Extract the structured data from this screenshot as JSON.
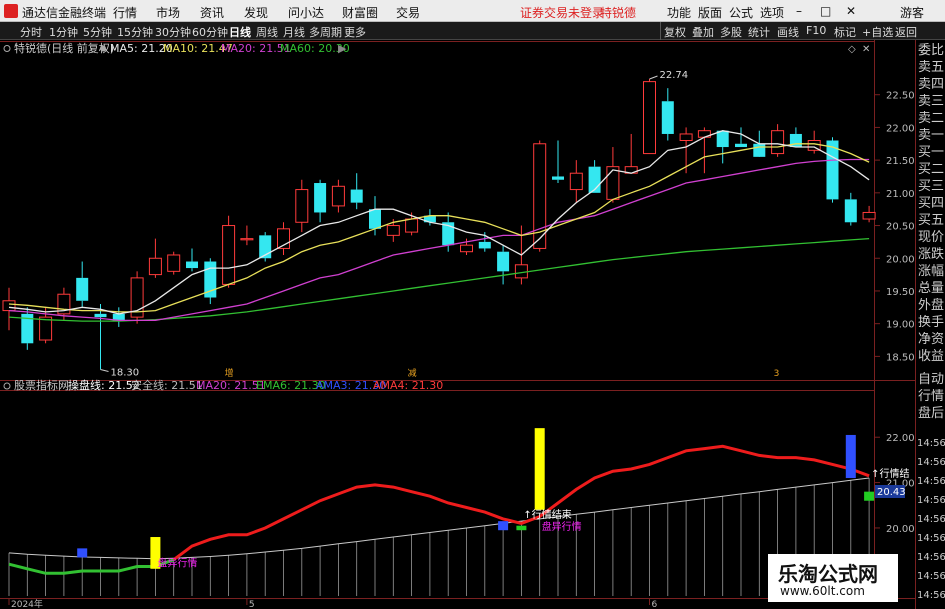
{
  "window": {
    "app_title": "通达信金融终端",
    "notice": "证券交易未登录",
    "stock": "特锐德",
    "min_btn": "–",
    "max_btn": "□",
    "close_btn": "✕"
  },
  "menu": {
    "left": [
      "行情",
      "市场",
      "资讯",
      "发现",
      "问小达",
      "财富圈",
      "交易"
    ],
    "right": [
      "功能",
      "版面",
      "公式",
      "选项"
    ],
    "guest": "游客"
  },
  "toolbar": {
    "periods": [
      "分时",
      "1分钟",
      "5分钟",
      "15分钟",
      "30分钟",
      "60分钟",
      "日线",
      "周线",
      "月线",
      "多周期",
      "更多"
    ],
    "active": "日线",
    "funcs": [
      "复权",
      "叠加",
      "多股",
      "统计",
      "画线",
      "F10",
      "标记",
      "+自选",
      "返回"
    ]
  },
  "colors": {
    "up": "#ff3b3b",
    "down": "#34e7f0",
    "ma5": "#e8e8e8",
    "ma10": "#e8e05a",
    "ma20": "#d040d0",
    "ma60": "#32c032",
    "buy": "#ee22ee"
  },
  "main_panel": {
    "title": "特锐德(日线 前复权)",
    "legend": [
      {
        "text": "MA5: 21.20",
        "color": "#e8e8e8"
      },
      {
        "text": "MA10: 21.47",
        "color": "#e8e05a"
      },
      {
        "text": "MA20: 21.51",
        "color": "#d040d0"
      },
      {
        "text": "MA60: 20.30",
        "color": "#32c032"
      }
    ],
    "high_label": "22.74",
    "low_label": "18.30",
    "events": [
      {
        "i": 12,
        "text": "增"
      },
      {
        "i": 22,
        "text": "减"
      },
      {
        "i": 42,
        "text": "3"
      }
    ]
  },
  "sub_panel": {
    "title": "股票指标网",
    "legend": [
      {
        "text": "操盘线: 21.52",
        "color": "#ffffff"
      },
      {
        "text": "安全线: 21.51",
        "color": "#bbbbbb"
      },
      {
        "text": "MA20: 21.51",
        "color": "#d040d0"
      },
      {
        "text": "EMA6: 21.30",
        "color": "#32c032"
      },
      {
        "text": "AMA3: 21.30",
        "color": "#3050ff"
      },
      {
        "text": "AMA4: 21.30",
        "color": "#ff3b3b"
      }
    ],
    "current_value": "20.43",
    "texts": [
      {
        "i": 8,
        "v": 19.15,
        "text": "盘异行情",
        "color": "#ee22ee"
      },
      {
        "i": 29,
        "v": 19.95,
        "text": "盘异行情",
        "color": "#ee22ee"
      },
      {
        "i": 28,
        "v": 20.22,
        "text": "↑行情结束",
        "color": "#ffffff"
      },
      {
        "i": 47,
        "v": 21.12,
        "text": "↑行情结",
        "color": "#ffffff"
      }
    ]
  },
  "x_labels": [
    {
      "i": 0,
      "text": "2024年"
    },
    {
      "i": 13,
      "text": "5"
    },
    {
      "i": 35,
      "text": "6"
    }
  ],
  "right_sidebar": {
    "items": [
      "委比",
      "卖五",
      "卖四",
      "卖三",
      "卖二",
      "卖一",
      "买一",
      "买二",
      "买三",
      "买四",
      "买五",
      "现价",
      "涨跌",
      "涨幅",
      "总量",
      "外盘",
      "换手",
      "净资",
      "收益",
      "自动",
      "行情",
      "盘后"
    ],
    "times": [
      "14:56",
      "14:56",
      "14:56",
      "14:56",
      "14:56",
      "14:56",
      "14:56",
      "14:56",
      "14:56"
    ]
  },
  "watermark": {
    "title": "乐淘公式网",
    "url": "www.60lt.com"
  },
  "chart_data": {
    "type": "candlestick",
    "main": {
      "y_ticks": [
        18.5,
        19.0,
        19.5,
        20.0,
        20.5,
        21.0,
        21.5,
        22.0,
        22.5
      ],
      "ylim": [
        18.2,
        23.0
      ],
      "candles": [
        [
          19.2,
          19.35,
          19.55,
          18.9
        ],
        [
          19.15,
          18.7,
          19.25,
          18.6
        ],
        [
          18.75,
          19.1,
          19.25,
          18.7
        ],
        [
          19.15,
          19.45,
          19.55,
          19.05
        ],
        [
          19.7,
          19.35,
          19.95,
          19.25
        ],
        [
          19.15,
          19.1,
          19.3,
          18.3
        ],
        [
          19.15,
          19.05,
          19.25,
          18.95
        ],
        [
          19.1,
          19.7,
          19.8,
          19.0
        ],
        [
          19.75,
          20.0,
          20.3,
          19.7
        ],
        [
          19.8,
          20.05,
          20.1,
          19.75
        ],
        [
          19.95,
          19.85,
          20.15,
          19.8
        ],
        [
          19.95,
          19.4,
          20.0,
          19.3
        ],
        [
          19.6,
          20.5,
          20.65,
          19.55
        ],
        [
          20.3,
          20.3,
          20.5,
          20.2
        ],
        [
          20.35,
          20.0,
          20.4,
          19.95
        ],
        [
          20.15,
          20.45,
          20.55,
          20.05
        ],
        [
          20.55,
          21.05,
          21.2,
          20.4
        ],
        [
          21.15,
          20.7,
          21.2,
          20.55
        ],
        [
          20.8,
          21.1,
          21.2,
          20.7
        ],
        [
          21.05,
          20.85,
          21.3,
          20.75
        ],
        [
          20.75,
          20.45,
          20.95,
          20.35
        ],
        [
          20.35,
          20.5,
          20.6,
          20.25
        ],
        [
          20.4,
          20.6,
          20.7,
          20.35
        ],
        [
          20.65,
          20.55,
          20.75,
          20.5
        ],
        [
          20.55,
          20.2,
          20.7,
          20.1
        ],
        [
          20.1,
          20.2,
          20.3,
          20.05
        ],
        [
          20.25,
          20.15,
          20.4,
          20.1
        ],
        [
          20.1,
          19.8,
          20.2,
          19.6
        ],
        [
          19.7,
          19.9,
          20.5,
          19.6
        ],
        [
          20.15,
          21.75,
          21.8,
          20.1
        ],
        [
          21.25,
          21.2,
          21.8,
          21.15
        ],
        [
          21.05,
          21.3,
          21.5,
          20.85
        ],
        [
          21.4,
          21.0,
          21.5,
          21.0
        ],
        [
          20.9,
          21.4,
          21.7,
          20.85
        ],
        [
          21.3,
          21.4,
          21.9,
          21.3
        ],
        [
          21.6,
          22.7,
          22.74,
          21.6
        ],
        [
          22.4,
          21.9,
          22.6,
          21.8
        ],
        [
          21.8,
          21.9,
          22.0,
          21.3
        ],
        [
          21.85,
          21.95,
          22.0,
          21.3
        ],
        [
          21.95,
          21.7,
          21.95,
          21.45
        ],
        [
          21.75,
          21.7,
          22.0,
          21.7
        ],
        [
          21.75,
          21.55,
          21.95,
          21.6
        ],
        [
          21.6,
          21.95,
          22.05,
          21.55
        ],
        [
          21.9,
          21.7,
          22.0,
          21.7
        ],
        [
          21.65,
          21.8,
          21.95,
          21.6
        ],
        [
          21.8,
          20.9,
          21.85,
          20.85
        ],
        [
          20.9,
          20.55,
          21.0,
          20.5
        ],
        [
          20.6,
          20.7,
          20.8,
          20.55
        ]
      ],
      "ma5": [
        19.25,
        19.22,
        19.18,
        19.2,
        19.25,
        19.22,
        19.15,
        19.2,
        19.35,
        19.55,
        19.75,
        19.85,
        19.85,
        19.9,
        20.05,
        20.2,
        20.35,
        20.5,
        20.55,
        20.65,
        20.75,
        20.75,
        20.65,
        20.55,
        20.5,
        20.4,
        20.35,
        20.2,
        20.05,
        20.3,
        20.6,
        20.85,
        21.05,
        21.35,
        21.3,
        21.4,
        21.65,
        21.7,
        21.85,
        21.95,
        21.9,
        21.75,
        21.75,
        21.7,
        21.7,
        21.55,
        21.4,
        21.2
      ],
      "ma10": [
        19.3,
        19.28,
        19.25,
        19.22,
        19.2,
        19.2,
        19.18,
        19.18,
        19.2,
        19.3,
        19.4,
        19.5,
        19.6,
        19.7,
        19.85,
        19.95,
        20.1,
        20.2,
        20.25,
        20.35,
        20.45,
        20.55,
        20.6,
        20.65,
        20.65,
        20.6,
        20.55,
        20.45,
        20.35,
        20.4,
        20.5,
        20.6,
        20.7,
        20.9,
        21.0,
        21.1,
        21.25,
        21.4,
        21.55,
        21.6,
        21.65,
        21.7,
        21.7,
        21.75,
        21.75,
        21.7,
        21.6,
        21.47
      ],
      "ma20": [
        19.2,
        19.18,
        19.15,
        19.12,
        19.1,
        19.08,
        19.05,
        19.05,
        19.05,
        19.1,
        19.15,
        19.2,
        19.25,
        19.3,
        19.4,
        19.5,
        19.6,
        19.7,
        19.75,
        19.85,
        19.95,
        20.05,
        20.1,
        20.15,
        20.2,
        20.25,
        20.3,
        20.35,
        20.35,
        20.45,
        20.55,
        20.6,
        20.65,
        20.75,
        20.85,
        20.95,
        21.05,
        21.15,
        21.2,
        21.25,
        21.3,
        21.35,
        21.4,
        21.45,
        21.48,
        21.5,
        21.51,
        21.51
      ],
      "ma60": [
        19.1,
        19.08,
        19.06,
        19.05,
        19.04,
        19.04,
        19.04,
        19.05,
        19.06,
        19.08,
        19.1,
        19.12,
        19.15,
        19.18,
        19.22,
        19.26,
        19.3,
        19.34,
        19.38,
        19.42,
        19.46,
        19.5,
        19.54,
        19.58,
        19.62,
        19.66,
        19.7,
        19.74,
        19.78,
        19.82,
        19.86,
        19.9,
        19.94,
        19.98,
        20.01,
        20.04,
        20.07,
        20.1,
        20.12,
        20.14,
        20.16,
        20.18,
        20.2,
        20.22,
        20.24,
        20.26,
        20.28,
        20.3
      ]
    },
    "sub": {
      "y_ticks": [
        20.0,
        21.0,
        22.0
      ],
      "ylim": [
        18.5,
        22.6
      ],
      "caopan": [
        19.45,
        19.42,
        19.4,
        19.38,
        19.36,
        19.35,
        19.34,
        19.33,
        19.32,
        19.33,
        19.35,
        19.37,
        19.4,
        19.43,
        19.47,
        19.51,
        19.55,
        19.6,
        19.65,
        19.7,
        19.75,
        19.8,
        19.85,
        19.9,
        19.95,
        20.0,
        20.05,
        20.1,
        20.15,
        20.2,
        20.25,
        20.3,
        20.35,
        20.4,
        20.45,
        20.5,
        20.55,
        20.6,
        20.65,
        20.7,
        20.75,
        20.8,
        20.85,
        20.9,
        20.95,
        21.0,
        21.05,
        21.1
      ],
      "anquan": [
        19.2,
        19.1,
        19.0,
        19.0,
        19.05,
        19.05,
        19.05,
        19.15,
        19.15,
        19.3,
        19.6,
        19.75,
        19.85,
        19.85,
        20.0,
        20.2,
        20.4,
        20.6,
        20.75,
        20.9,
        20.95,
        20.9,
        20.8,
        20.7,
        20.55,
        20.45,
        20.35,
        20.2,
        20.1,
        20.25,
        20.55,
        20.85,
        21.1,
        21.25,
        21.3,
        21.4,
        21.55,
        21.7,
        21.75,
        21.8,
        21.7,
        21.6,
        21.55,
        21.55,
        21.5,
        21.4,
        21.3,
        21.15
      ],
      "red_from": 9,
      "bars": [
        {
          "i": 4,
          "lo": 19.35,
          "hi": 19.55,
          "color": "#3050ff"
        },
        {
          "i": 8,
          "lo": 19.1,
          "hi": 19.8,
          "color": "#ffff00"
        },
        {
          "i": 27,
          "lo": 19.95,
          "hi": 20.15,
          "color": "#3050ff"
        },
        {
          "i": 28,
          "lo": 19.95,
          "hi": 20.05,
          "color": "#22cc22"
        },
        {
          "i": 29,
          "lo": 20.4,
          "hi": 22.2,
          "color": "#ffff00"
        },
        {
          "i": 46,
          "lo": 21.1,
          "hi": 22.05,
          "color": "#3050ff"
        },
        {
          "i": 47,
          "lo": 20.6,
          "hi": 20.8,
          "color": "#22cc22"
        }
      ]
    }
  }
}
